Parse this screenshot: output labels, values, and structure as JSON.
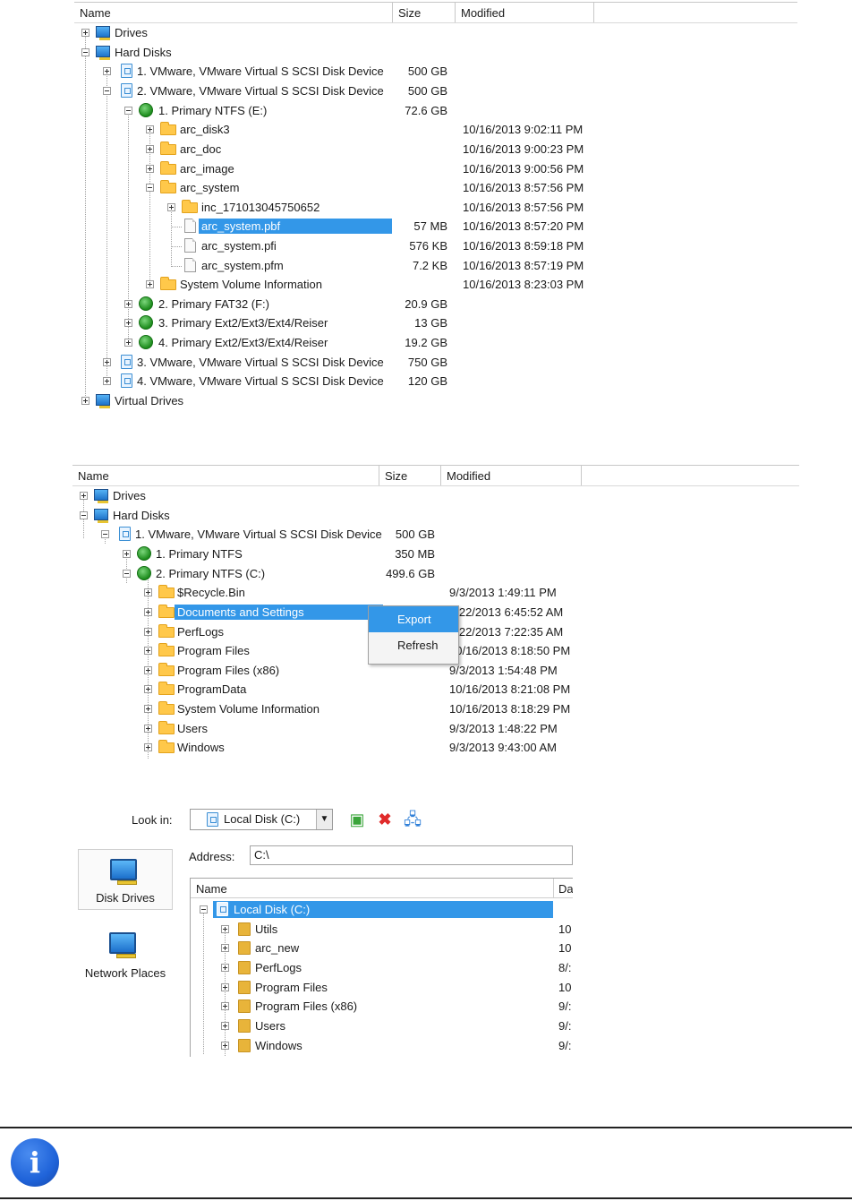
{
  "panel1": {
    "headers": {
      "name": "Name",
      "size": "Size",
      "modified": "Modified"
    },
    "rows": [
      {
        "name": "Drives",
        "size": "",
        "modified": ""
      },
      {
        "name": "Hard Disks",
        "size": "",
        "modified": ""
      },
      {
        "name": "1. VMware, VMware Virtual S SCSI Disk Device",
        "size": "500 GB",
        "modified": ""
      },
      {
        "name": "2. VMware, VMware Virtual S SCSI Disk Device",
        "size": "500 GB",
        "modified": ""
      },
      {
        "name": "1. Primary NTFS (E:)",
        "size": "72.6 GB",
        "modified": ""
      },
      {
        "name": "arc_disk3",
        "size": "",
        "modified": "10/16/2013 9:02:11 PM"
      },
      {
        "name": "arc_doc",
        "size": "",
        "modified": "10/16/2013 9:00:23 PM"
      },
      {
        "name": "arc_image",
        "size": "",
        "modified": "10/16/2013 9:00:56 PM"
      },
      {
        "name": "arc_system",
        "size": "",
        "modified": "10/16/2013 8:57:56 PM"
      },
      {
        "name": "inc_171013045750652",
        "size": "",
        "modified": "10/16/2013 8:57:56 PM"
      },
      {
        "name": "arc_system.pbf",
        "size": "57 MB",
        "modified": "10/16/2013 8:57:20 PM"
      },
      {
        "name": "arc_system.pfi",
        "size": "576 KB",
        "modified": "10/16/2013 8:59:18 PM"
      },
      {
        "name": "arc_system.pfm",
        "size": "7.2 KB",
        "modified": "10/16/2013 8:57:19 PM"
      },
      {
        "name": "System Volume Information",
        "size": "",
        "modified": "10/16/2013 8:23:03 PM"
      },
      {
        "name": "2. Primary FAT32 (F:)",
        "size": "20.9 GB",
        "modified": ""
      },
      {
        "name": "3. Primary Ext2/Ext3/Ext4/Reiser",
        "size": "13 GB",
        "modified": ""
      },
      {
        "name": "4. Primary Ext2/Ext3/Ext4/Reiser",
        "size": "19.2 GB",
        "modified": ""
      },
      {
        "name": "3. VMware, VMware Virtual S SCSI Disk Device",
        "size": "750 GB",
        "modified": ""
      },
      {
        "name": "4. VMware, VMware Virtual S SCSI Disk Device",
        "size": "120 GB",
        "modified": ""
      },
      {
        "name": "Virtual Drives",
        "size": "",
        "modified": ""
      }
    ]
  },
  "panel2": {
    "headers": {
      "name": "Name",
      "size": "Size",
      "modified": "Modified"
    },
    "rows": [
      {
        "name": "Drives",
        "size": "",
        "modified": ""
      },
      {
        "name": "Hard Disks",
        "size": "",
        "modified": ""
      },
      {
        "name": "1. VMware, VMware Virtual S SCSI Disk Device",
        "size": "500 GB",
        "modified": ""
      },
      {
        "name": "1. Primary NTFS",
        "size": "350 MB",
        "modified": ""
      },
      {
        "name": "2. Primary NTFS (C:)",
        "size": "499.6 GB",
        "modified": ""
      },
      {
        "name": "$Recycle.Bin",
        "size": "",
        "modified": "9/3/2013 1:49:11 PM"
      },
      {
        "name": "Documents and Settings",
        "size": "",
        "modified": "7/22/2013 6:45:52 AM"
      },
      {
        "name": "PerfLogs",
        "size": "",
        "modified": "7/22/2013 7:22:35 AM"
      },
      {
        "name": "Program Files",
        "size": "",
        "modified": "10/16/2013 8:18:50 PM"
      },
      {
        "name": "Program Files (x86)",
        "size": "",
        "modified": "9/3/2013 1:54:48 PM"
      },
      {
        "name": "ProgramData",
        "size": "",
        "modified": "10/16/2013 8:21:08 PM"
      },
      {
        "name": "System Volume Information",
        "size": "",
        "modified": "10/16/2013 8:18:29 PM"
      },
      {
        "name": "Users",
        "size": "",
        "modified": "9/3/2013 1:48:22 PM"
      },
      {
        "name": "Windows",
        "size": "",
        "modified": "9/3/2013 9:43:00 AM"
      }
    ],
    "context_menu": {
      "export": "Export",
      "refresh": "Refresh"
    }
  },
  "panel3": {
    "look_in_label": "Look in:",
    "look_in_value": "Local Disk (C:)",
    "address_label": "Address:",
    "address_value": "C:\\",
    "places": [
      {
        "label": "Disk Drives"
      },
      {
        "label": "Network Places"
      }
    ],
    "headers": {
      "name": "Name",
      "date": "Da"
    },
    "rows": [
      {
        "name": "Local Disk (C:)",
        "date": ""
      },
      {
        "name": "Utils",
        "date": "10"
      },
      {
        "name": "arc_new",
        "date": "10"
      },
      {
        "name": "PerfLogs",
        "date": "8/:"
      },
      {
        "name": "Program Files",
        "date": "10"
      },
      {
        "name": "Program Files (x86)",
        "date": "9/:"
      },
      {
        "name": "Users",
        "date": "9/:"
      },
      {
        "name": "Windows",
        "date": "9/:"
      }
    ]
  },
  "colors": {
    "selection": "#3397e8",
    "info_icon": "#1f63d9"
  },
  "icons": {
    "info": "i"
  }
}
